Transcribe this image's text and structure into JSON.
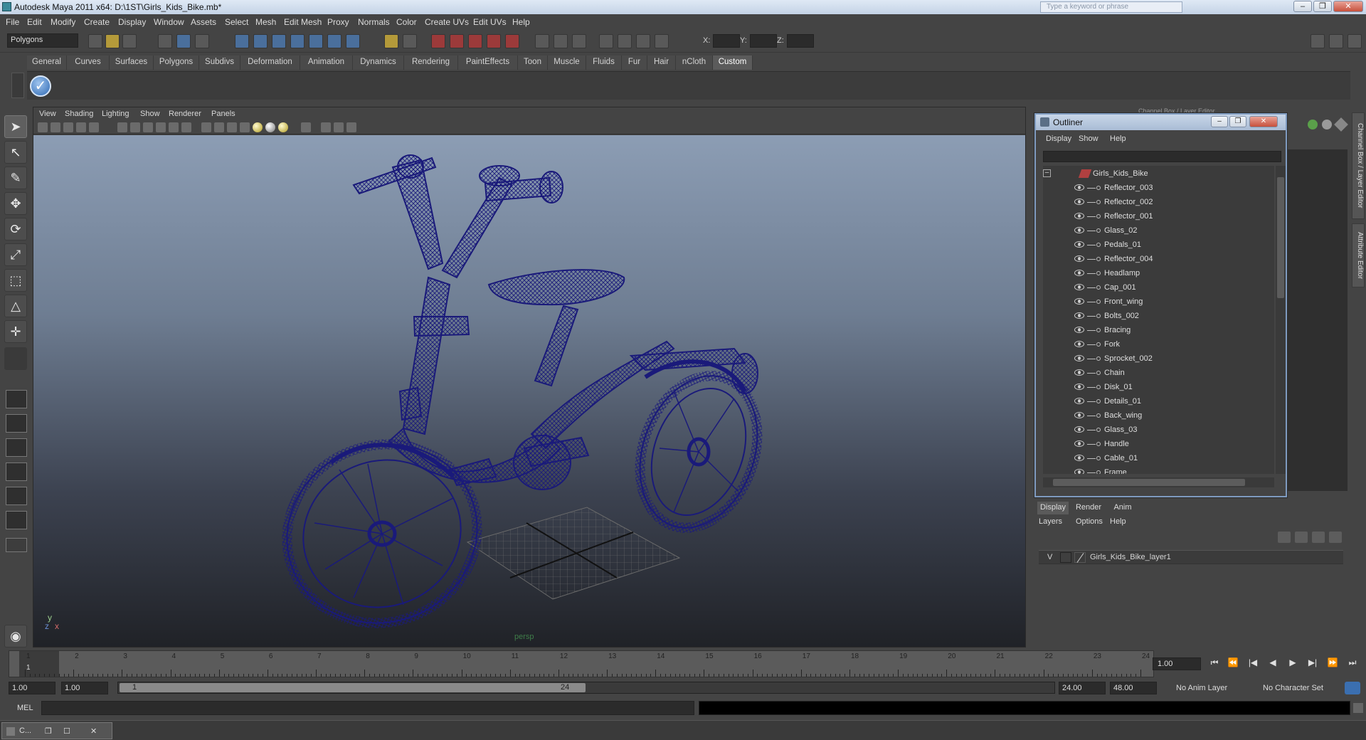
{
  "window": {
    "title": "Autodesk Maya 2011 x64: D:\\1ST\\Girls_Kids_Bike.mb*",
    "search_placeholder": "Type a keyword or phrase",
    "controls": [
      "–",
      "❐",
      "✕"
    ]
  },
  "menu": [
    "File",
    "Edit",
    "Modify",
    "Create",
    "Display",
    "Window",
    "Assets",
    "Select",
    "Mesh",
    "Edit Mesh",
    "Proxy",
    "Normals",
    "Color",
    "Create UVs",
    "Edit UVs",
    "Help"
  ],
  "statusline": {
    "mode": "Polygons",
    "x_label": "X:",
    "y_label": "Y:",
    "z_label": "Z:"
  },
  "shelf": {
    "tabs": [
      "General",
      "Curves",
      "Surfaces",
      "Polygons",
      "Subdivs",
      "Deformation",
      "Animation",
      "Dynamics",
      "Rendering",
      "PaintEffects",
      "Toon",
      "Muscle",
      "Fluids",
      "Fur",
      "Hair",
      "nCloth",
      "Custom"
    ],
    "active_tab": "Custom",
    "check_glyph": "✓"
  },
  "viewport": {
    "menu": [
      "View",
      "Shading",
      "Lighting",
      "Show",
      "Renderer",
      "Panels"
    ],
    "camera_label": "persp",
    "axis": {
      "y": "y",
      "x": "x",
      "z": "z"
    }
  },
  "channel_box": {
    "header": "Channel Box / Layer Editor",
    "side_tabs": [
      "Channel Box / Layer Editor",
      "Attribute Editor"
    ]
  },
  "outliner": {
    "title": "Outliner",
    "controls": [
      "–",
      "❐",
      "✕"
    ],
    "menu": [
      "Display",
      "Show",
      "Help"
    ],
    "root": "Girls_Kids_Bike",
    "collapse_glyph": "–",
    "items": [
      "Reflector_003",
      "Reflector_002",
      "Reflector_001",
      "Glass_02",
      "Pedals_01",
      "Reflector_004",
      "Headlamp",
      "Cap_001",
      "Front_wing",
      "Bolts_002",
      "Bracing",
      "Fork",
      "Sprocket_002",
      "Chain",
      "Disk_01",
      "Details_01",
      "Back_wing",
      "Glass_03",
      "Handle",
      "Cable_01",
      "Frame"
    ]
  },
  "layer_editor": {
    "tabs": [
      "Display",
      "Render",
      "Anim"
    ],
    "active_tab": "Display",
    "menu": [
      "Layers",
      "Options",
      "Help"
    ],
    "layer": {
      "visible": "V",
      "name": "Girls_Kids_Bike_layer1"
    }
  },
  "timeline": {
    "ticks": [
      "1",
      "2",
      "3",
      "4",
      "5",
      "6",
      "7",
      "8",
      "9",
      "10",
      "11",
      "12",
      "13",
      "14",
      "15",
      "16",
      "17",
      "18",
      "19",
      "20",
      "21",
      "22",
      "23",
      "24"
    ],
    "current_frame_label": "1",
    "current_time": "1.00",
    "playback_glyphs": [
      "⏮",
      "⏪",
      "|◀",
      "◀",
      "▶",
      "▶|",
      "⏩",
      "⏭"
    ]
  },
  "range": {
    "start_time": "1.00",
    "playback_start": "1.00",
    "range_start_label": "1",
    "range_end_label": "24",
    "playback_end": "24.00",
    "end_time": "48.00",
    "anim_layer": "No Anim Layer",
    "character_set": "No Character Set"
  },
  "command_line": {
    "label": "MEL"
  },
  "taskbar": {
    "task_label": "C...",
    "controls": [
      "❐",
      "☐",
      "✕"
    ]
  },
  "colors": {
    "wireframe": "#1a1a7a",
    "ui_bg": "#444444",
    "viewport_top": "#8c9db4",
    "viewport_bottom": "#202227"
  }
}
